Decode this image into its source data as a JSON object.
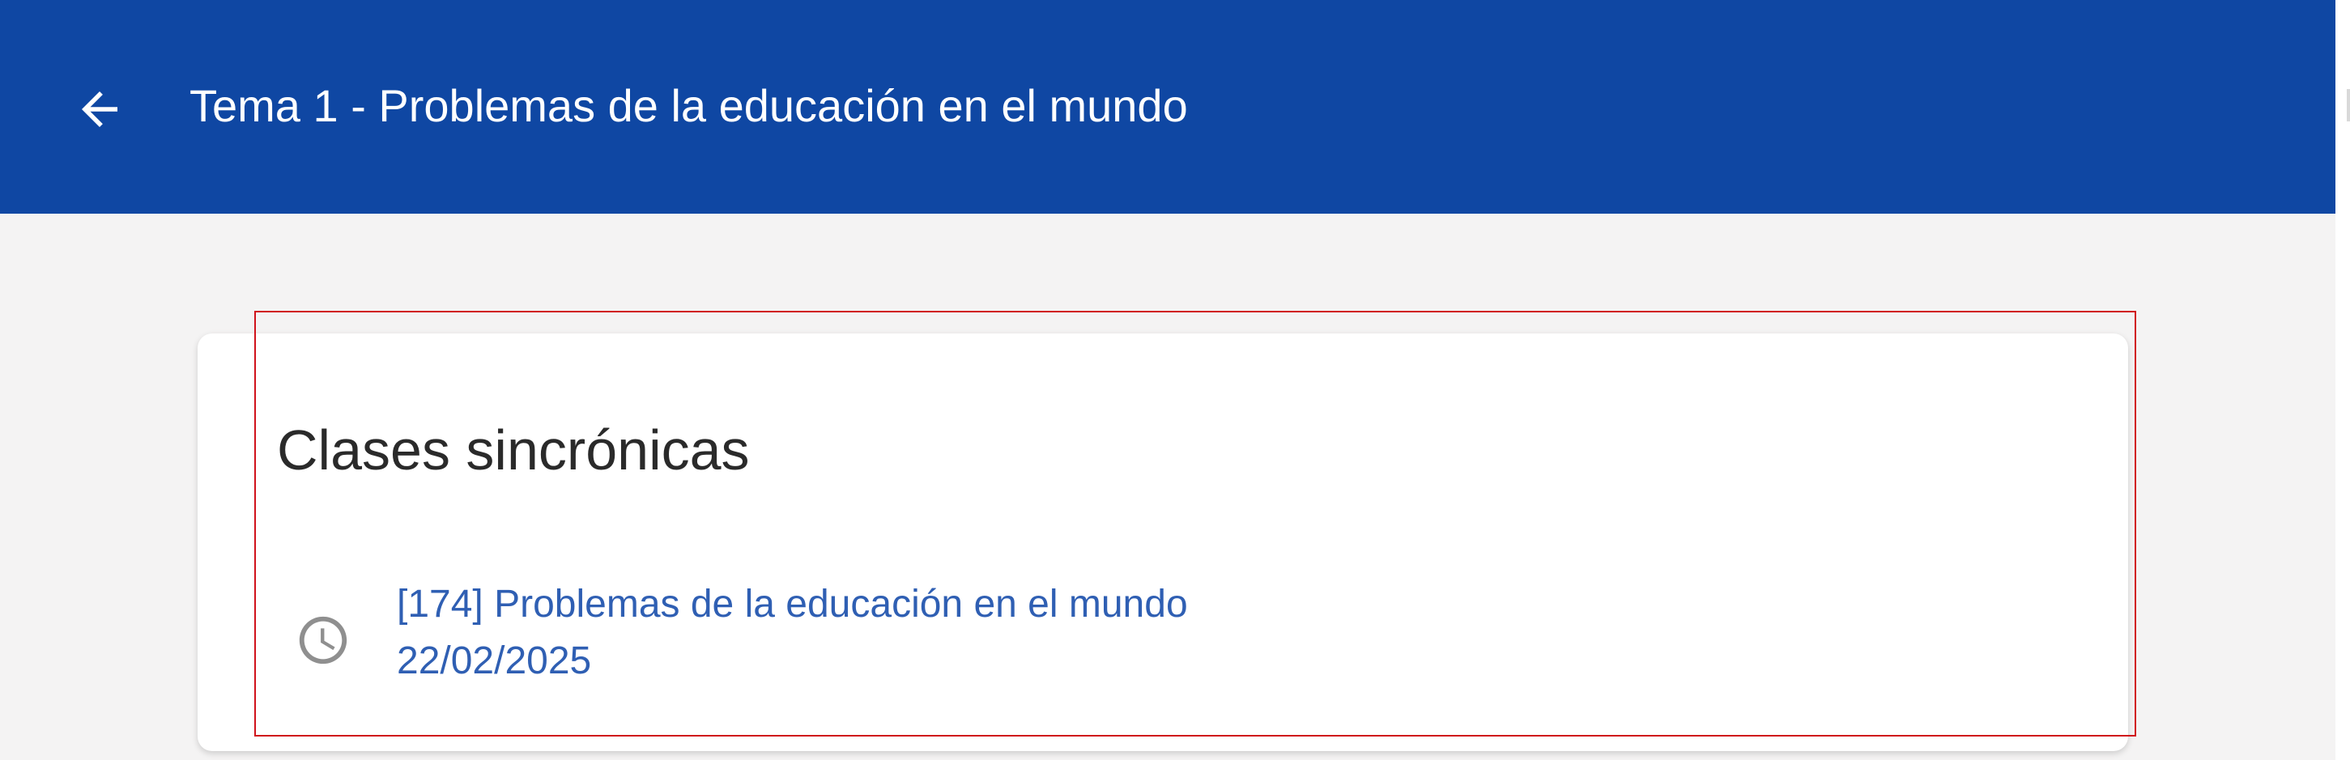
{
  "header": {
    "back_icon": "arrow-left-icon",
    "title": "Tema 1 - Problemas de la educación en el mundo"
  },
  "card": {
    "section_title": "Clases sincrónicas",
    "sessions": [
      {
        "icon": "clock-icon",
        "title": "[174] Problemas de la educación en el mundo",
        "date": "22/02/2025"
      }
    ]
  },
  "colors": {
    "app_bar": "#0f47a3",
    "background": "#f4f3f3",
    "link": "#2f5fb3",
    "highlight_border": "#d0121b"
  }
}
